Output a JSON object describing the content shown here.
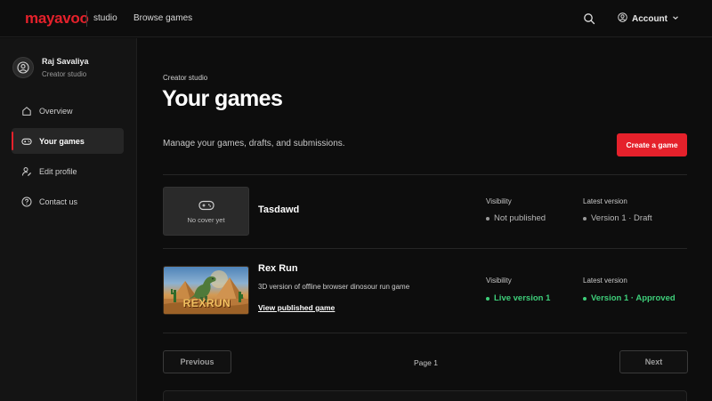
{
  "topbar": {
    "logo": "mayavoo",
    "section": "studio",
    "browse_label": "Browse games",
    "account_label": "Account"
  },
  "sidebar": {
    "user_name": "Raj Savaliya",
    "user_role": "Creator studio",
    "items": [
      {
        "label": "Overview",
        "icon": "home-icon",
        "active": false
      },
      {
        "label": "Your games",
        "icon": "gamepad-icon",
        "active": true
      },
      {
        "label": "Edit profile",
        "icon": "user-edit-icon",
        "active": false
      },
      {
        "label": "Contact us",
        "icon": "help-circle-icon",
        "active": false
      }
    ]
  },
  "main": {
    "breadcrumb": "Creator studio",
    "title": "Your games",
    "subtitle": "Manage your games, drafts, and submissions.",
    "create_button": "Create a game",
    "games": [
      {
        "title": "Tasdawd",
        "cover_placeholder": "No cover yet",
        "visibility_label": "Visibility",
        "visibility_value": "Not published",
        "version_label": "Latest version",
        "version_value": "Version 1 · Draft"
      },
      {
        "title": "Rex Run",
        "description": "3D version of offline browser dinosour run game",
        "link": "View published game",
        "cover_text": "REXRUN",
        "visibility_label": "Visibility",
        "visibility_value": "Live version 1",
        "version_label": "Latest version",
        "version_value": "Version 1 · Approved"
      }
    ],
    "pagination": {
      "previous": "Previous",
      "page": "Page 1",
      "next": "Next"
    }
  },
  "colors": {
    "brand": "#e5212b",
    "success": "#3ecf7a",
    "background": "#0d0d0d",
    "sidebar": "#141414"
  }
}
